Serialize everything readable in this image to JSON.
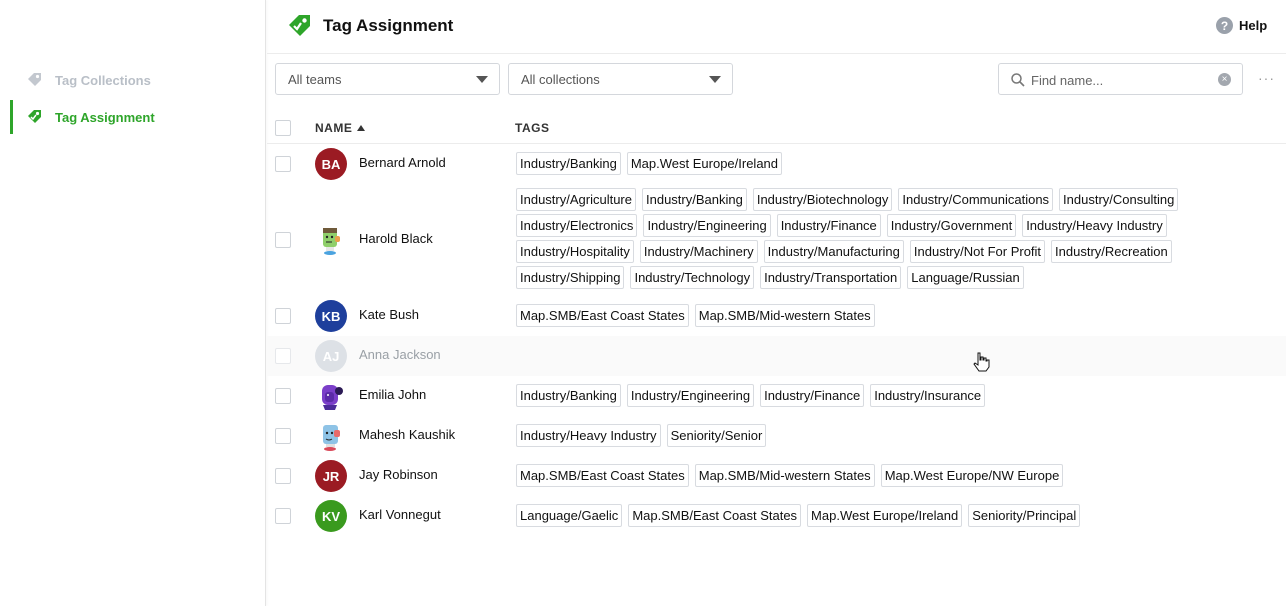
{
  "sidebar": {
    "items": [
      {
        "label": "Tag Collections",
        "icon": "tag-icon"
      },
      {
        "label": "Tag Assignment",
        "icon": "tag-icon"
      }
    ]
  },
  "header": {
    "title": "Tag Assignment",
    "help_label": "Help"
  },
  "filters": {
    "teams": "All teams",
    "collections": "All collections",
    "search_placeholder": "Find name...",
    "search_value": ""
  },
  "table": {
    "columns": [
      "NAME",
      "TAGS"
    ],
    "rows": [
      {
        "name": "Bernard Arnold",
        "initials": "BA",
        "avatar_color": "#9b1b23",
        "tags": [
          "Industry/Banking",
          "Map.West Europe/Ireland"
        ]
      },
      {
        "name": "Harold Black",
        "initials": "",
        "avatar_color": "illustrated-green",
        "tags": [
          "Industry/Agriculture",
          "Industry/Banking",
          "Industry/Biotechnology",
          "Industry/Communications",
          "Industry/Consulting",
          "Industry/Electronics",
          "Industry/Engineering",
          "Industry/Finance",
          "Industry/Government",
          "Industry/Heavy Industry",
          "Industry/Hospitality",
          "Industry/Machinery",
          "Industry/Manufacturing",
          "Industry/Not For Profit",
          "Industry/Recreation",
          "Industry/Shipping",
          "Industry/Technology",
          "Industry/Transportation",
          "Language/Russian"
        ]
      },
      {
        "name": "Kate Bush",
        "initials": "KB",
        "avatar_color": "#1e3f9c",
        "tags": [
          "Map.SMB/East Coast States",
          "Map.SMB/Mid-western States"
        ]
      },
      {
        "name": "Anna Jackson",
        "initials": "AJ",
        "avatar_color": "#dde1e6",
        "tags": []
      },
      {
        "name": "Emilia John",
        "initials": "",
        "avatar_color": "illustrated-purple",
        "tags": [
          "Industry/Banking",
          "Industry/Engineering",
          "Industry/Finance",
          "Industry/Insurance"
        ]
      },
      {
        "name": "Mahesh Kaushik",
        "initials": "",
        "avatar_color": "illustrated-blue",
        "tags": [
          "Industry/Heavy Industry",
          "Seniority/Senior"
        ]
      },
      {
        "name": "Jay Robinson",
        "initials": "JR",
        "avatar_color": "#9b1b23",
        "tags": [
          "Map.SMB/East Coast States",
          "Map.SMB/Mid-western States",
          "Map.West Europe/NW Europe"
        ]
      },
      {
        "name": "Karl Vonnegut",
        "initials": "KV",
        "avatar_color": "#3a9a1e",
        "tags": [
          "Language/Gaelic",
          "Map.SMB/East Coast States",
          "Map.West Europe/Ireland",
          "Seniority/Principal"
        ]
      }
    ]
  },
  "colors": {
    "accent": "#2ea52a",
    "inactive": "#b9bfc7"
  }
}
